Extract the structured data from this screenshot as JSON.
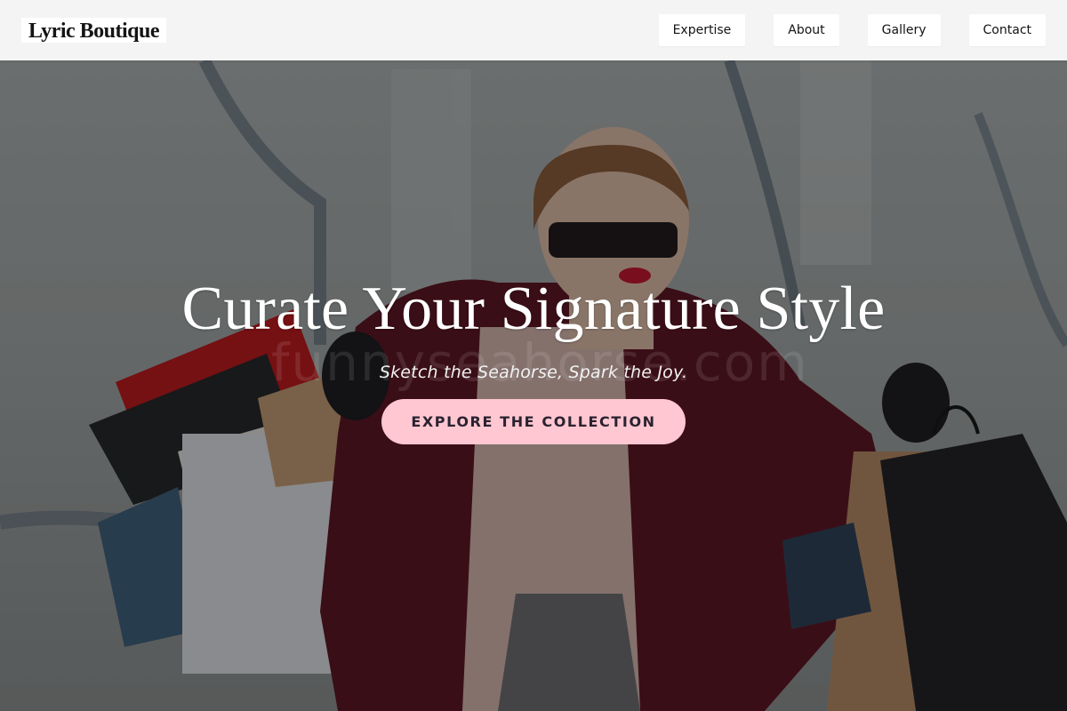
{
  "header": {
    "brand": "Lyric Boutique",
    "nav": [
      {
        "label": "Expertise"
      },
      {
        "label": "About"
      },
      {
        "label": "Gallery"
      },
      {
        "label": "Contact"
      }
    ]
  },
  "hero": {
    "title": "Curate Your Signature Style",
    "tagline": "Sketch the Seahorse, Spark the Joy.",
    "cta_label": "EXPLORE THE COLLECTION",
    "watermark": "funnyseahorse.com"
  },
  "colors": {
    "header_bg": "#f4f4f4",
    "cta_bg": "#ffc7d1",
    "coat": "#5a0f1e",
    "bag_red": "#c01218"
  }
}
